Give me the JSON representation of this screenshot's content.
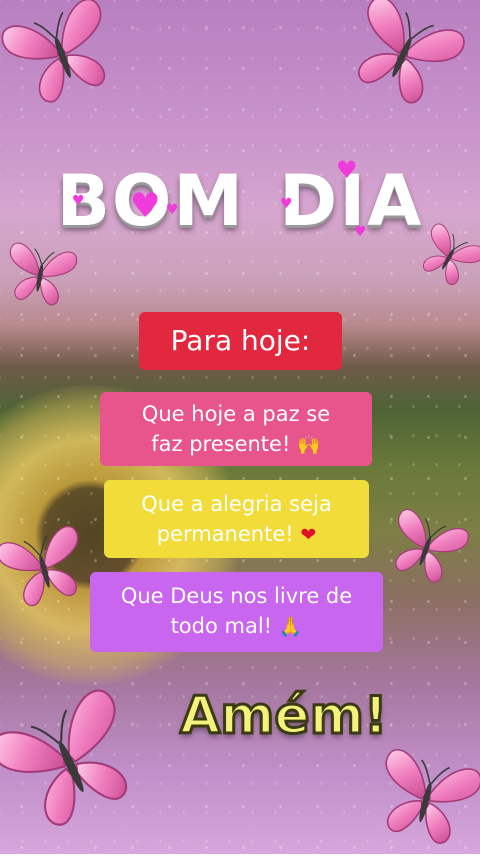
{
  "title": {
    "word1": "BOM",
    "word2": "DIA"
  },
  "header": {
    "text": "Para hoje:"
  },
  "messages": [
    {
      "line1": "Que hoje a paz se",
      "line2": "faz presente!",
      "emoji": "🙌"
    },
    {
      "line1": "Que a alegria seja",
      "line2": "permanente!",
      "emoji": "❤"
    },
    {
      "line1": "Que Deus nos livre de",
      "line2": "todo mal!",
      "emoji": "🙏"
    }
  ],
  "closing": {
    "text": "Amém!"
  },
  "colors": {
    "header_bg": "#e2283e",
    "msg1_bg": "#e8558c",
    "msg2_bg": "#f1dc3a",
    "msg3_bg": "#c966f0",
    "butterfly": "#f07fbf",
    "heart": "#ef3bd9"
  },
  "icons": [
    "butterfly-icon",
    "heart-icon",
    "raising-hands-emoji",
    "red-heart-emoji",
    "praying-hands-emoji"
  ]
}
